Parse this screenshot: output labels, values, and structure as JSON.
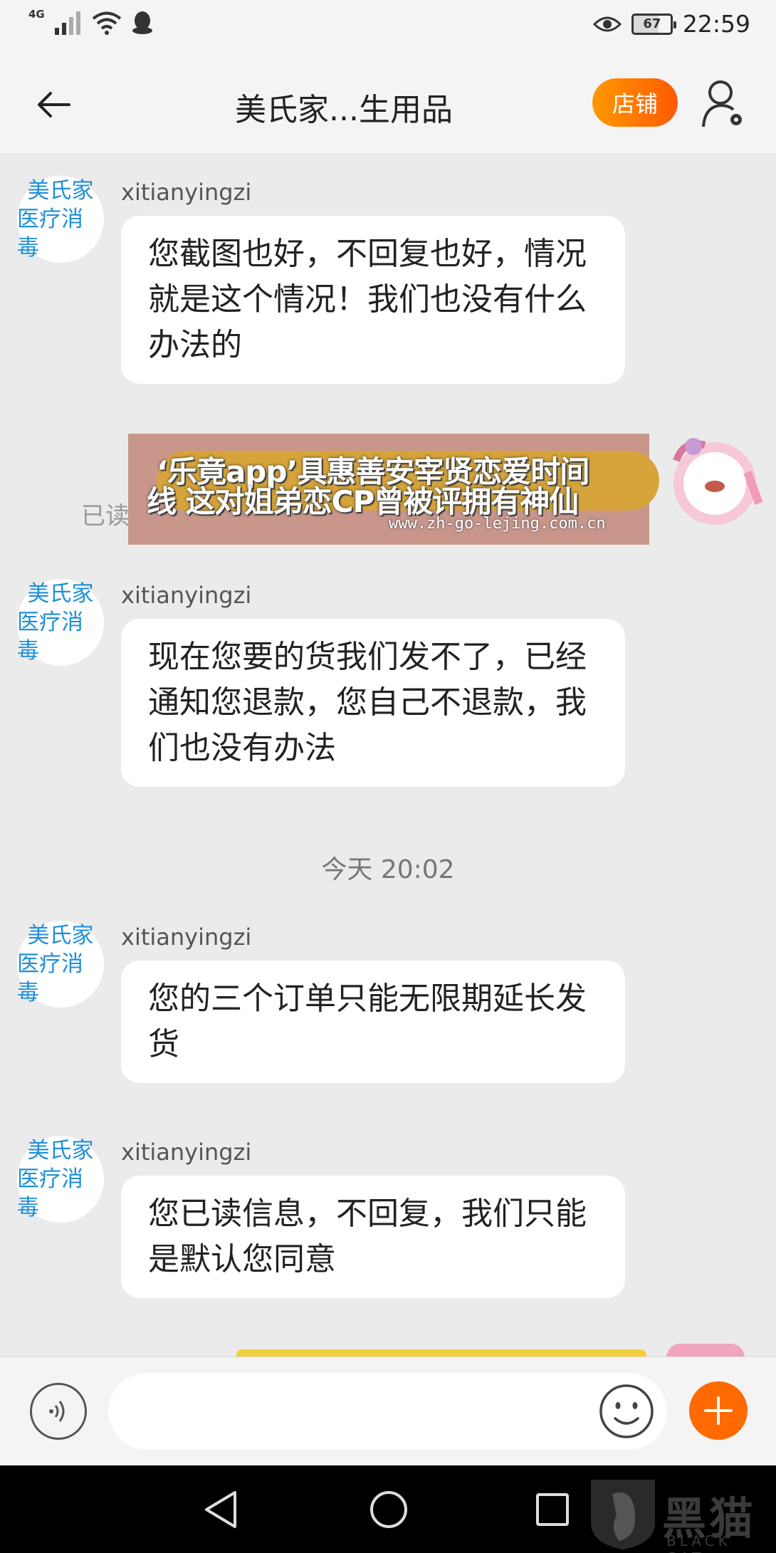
{
  "status_bar": {
    "network": "4G",
    "battery": "67",
    "time": "22:59"
  },
  "nav": {
    "title": "美氏家...生用品",
    "shop_button": "店铺"
  },
  "avatar": {
    "line1": "美氏家",
    "line2": "医疗消毒"
  },
  "messages": [
    {
      "sender": "xitianyingzi",
      "text": "您截图也好，不回复也好，情况就是这个情况！我们也没有什么办法的"
    },
    {
      "sender": "xitianyingzi",
      "text": "现在您要的货我们发不了，已经通知您退款，您自己不退款，我们也没有办法"
    },
    {
      "sender": "xitianyingzi",
      "text": "您的三个订单只能无限期延长发货"
    },
    {
      "sender": "xitianyingzi",
      "text": "您已读信息，不回复，我们只能是默认您同意"
    }
  ],
  "time_separator": "今天  20:02",
  "read_status": "已读",
  "ad": {
    "line1": "‘乐竟app’具惠善安宰贤恋爱时间",
    "line2": "线 这对姐弟恋CP曾被评拥有神仙",
    "url": "www.zh-go-lejing.com.cn"
  },
  "input": {
    "placeholder": "",
    "value": ""
  },
  "watermark": {
    "brand": "黑猫",
    "sub": "BLACK CAT"
  }
}
